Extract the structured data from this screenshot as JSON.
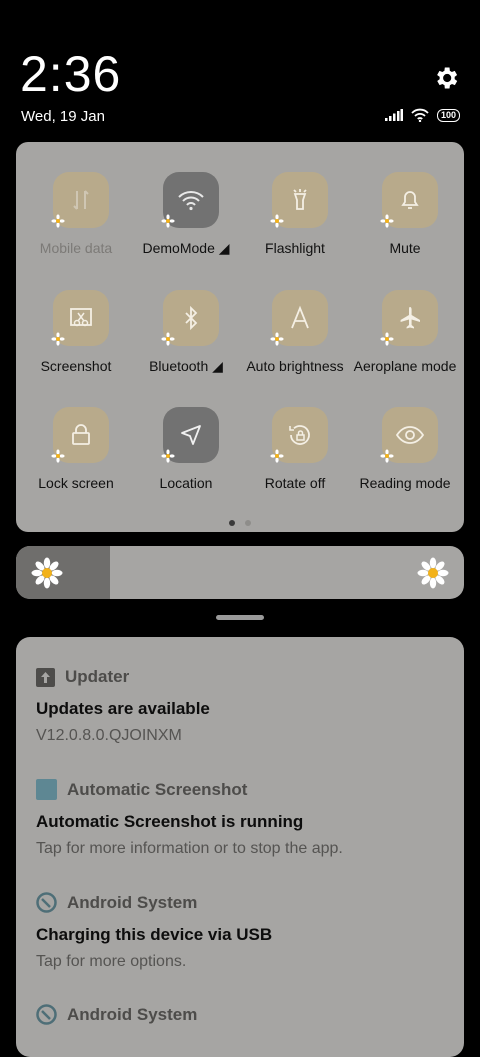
{
  "status": {
    "time": "2:36",
    "date": "Wed, 19 Jan",
    "battery": "100",
    "icons": [
      "signal-icon",
      "wifi-icon",
      "battery-icon",
      "settings-gear-icon"
    ]
  },
  "quick_settings": {
    "tiles": [
      {
        "name": "mobile-data",
        "label": "Mobile data",
        "icon": "mobile-data-icon",
        "active": false,
        "disabled": true
      },
      {
        "name": "demomode",
        "label": "DemoMode ◢",
        "icon": "wifi-icon",
        "active": true
      },
      {
        "name": "flashlight",
        "label": "Flashlight",
        "icon": "flashlight-icon",
        "active": false
      },
      {
        "name": "mute",
        "label": "Mute",
        "icon": "bell-icon",
        "active": false
      },
      {
        "name": "screenshot",
        "label": "Screenshot",
        "icon": "screenshot-icon",
        "active": false
      },
      {
        "name": "bluetooth",
        "label": "Bluetooth ◢",
        "icon": "bluetooth-icon",
        "active": false
      },
      {
        "name": "auto-brightness",
        "label": "Auto brightness",
        "icon": "letter-a-icon",
        "active": false
      },
      {
        "name": "aeroplane-mode",
        "label": "Aeroplane mode",
        "icon": "aeroplane-icon",
        "active": false
      },
      {
        "name": "lock-screen",
        "label": "Lock screen",
        "icon": "lock-icon",
        "active": false
      },
      {
        "name": "location",
        "label": "Location",
        "icon": "location-arrow-icon",
        "active": true
      },
      {
        "name": "rotate-off",
        "label": "Rotate off",
        "icon": "rotate-lock-icon",
        "active": false
      },
      {
        "name": "reading-mode",
        "label": "Reading mode",
        "icon": "eye-icon",
        "active": false
      }
    ],
    "page_count": 2,
    "current_page": 1
  },
  "brightness": {
    "level": 0.21
  },
  "notifications": [
    {
      "app": "Updater",
      "app_icon": "updater-arrow-icon",
      "title": "Updates are available",
      "text": "V12.0.8.0.QJOINXM"
    },
    {
      "app": "Automatic Screenshot",
      "app_icon": "screenshot-app-icon",
      "title": "Automatic Screenshot is running",
      "text": "Tap for more information or to stop the app."
    },
    {
      "app": "Android System",
      "app_icon": "android-system-icon",
      "title": "Charging this device via USB",
      "text": "Tap for more options."
    },
    {
      "app": "Android System",
      "app_icon": "android-system-icon",
      "title": "",
      "text": ""
    }
  ]
}
